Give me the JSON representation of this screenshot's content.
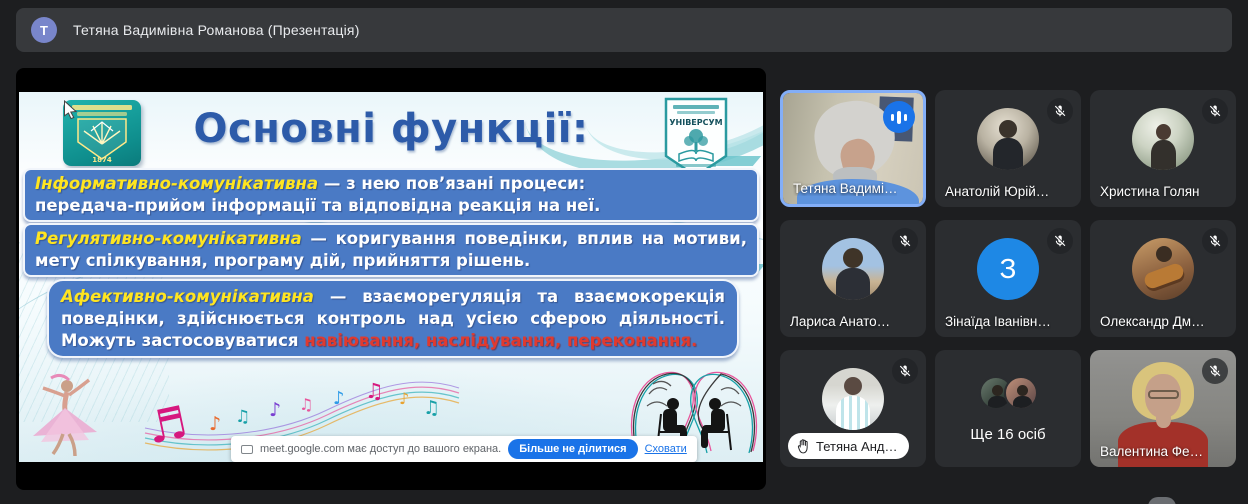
{
  "colors": {
    "accent_blue": "#1a73e8",
    "speaking_border": "#83aef7",
    "presenter_avatar_bg": "#7986cb",
    "initial_avatar_bg": "#1e88e5",
    "slide_block_blue": "#4a7ac5",
    "slide_term_yellow": "#ffe520",
    "slide_highlight_red": "#e03a2f",
    "slide_title_blue": "#2d5ba9"
  },
  "top_bar": {
    "avatar_initial": "T",
    "title": "Тетяна Вадимівна Романова (Презентація)"
  },
  "presentation": {
    "slide": {
      "title": "Основні функції:",
      "left_emblem_year": "1874",
      "right_emblem_text": "УНІВЕРСУМ",
      "blocks": [
        {
          "term": "Інформативно-комунікативна",
          "rest": " — з нею пов’язані процеси:\nпередача-прийом інформації та відповідна реакція на неї."
        },
        {
          "term": "Регулятивно-комунікативна",
          "rest": " — коригування поведінки, вплив на мотиви, мету спілкування, програму дій, прийняття рішень."
        },
        {
          "term": "Афективно-комунікативна",
          "rest": " — взаєморегуляція та взаємокорекція поведінки, здійснюється контроль над усією сферою діяльності. Можуть застосовуватися ",
          "highlight": "навіювання, наслідування, переконання."
        }
      ]
    },
    "share_banner": {
      "message": "meet.google.com має доступ до вашого екрана.",
      "stop_button": "Більше не ділитися",
      "hide_link": "Сховати"
    }
  },
  "participants": [
    {
      "name": "Тетяна Вадимі…",
      "type": "video",
      "speaking": true,
      "muted": false
    },
    {
      "name": "Анатолій Юрій…",
      "type": "avatar",
      "muted": true
    },
    {
      "name": "Христина Голян",
      "type": "avatar",
      "muted": true
    },
    {
      "name": "Лариса Анато…",
      "type": "avatar",
      "muted": true
    },
    {
      "name": "Зінаїда Іванівн…",
      "type": "initial",
      "initial": "З",
      "muted": true
    },
    {
      "name": "Олександр Дм…",
      "type": "avatar",
      "muted": true
    },
    {
      "name": "Тетяна Анд…",
      "type": "avatar",
      "muted": true,
      "hand_raised": true
    },
    {
      "name": "Ще 16 осіб",
      "type": "overflow"
    },
    {
      "name": "Валентина Фе…",
      "type": "video",
      "muted": true
    }
  ]
}
